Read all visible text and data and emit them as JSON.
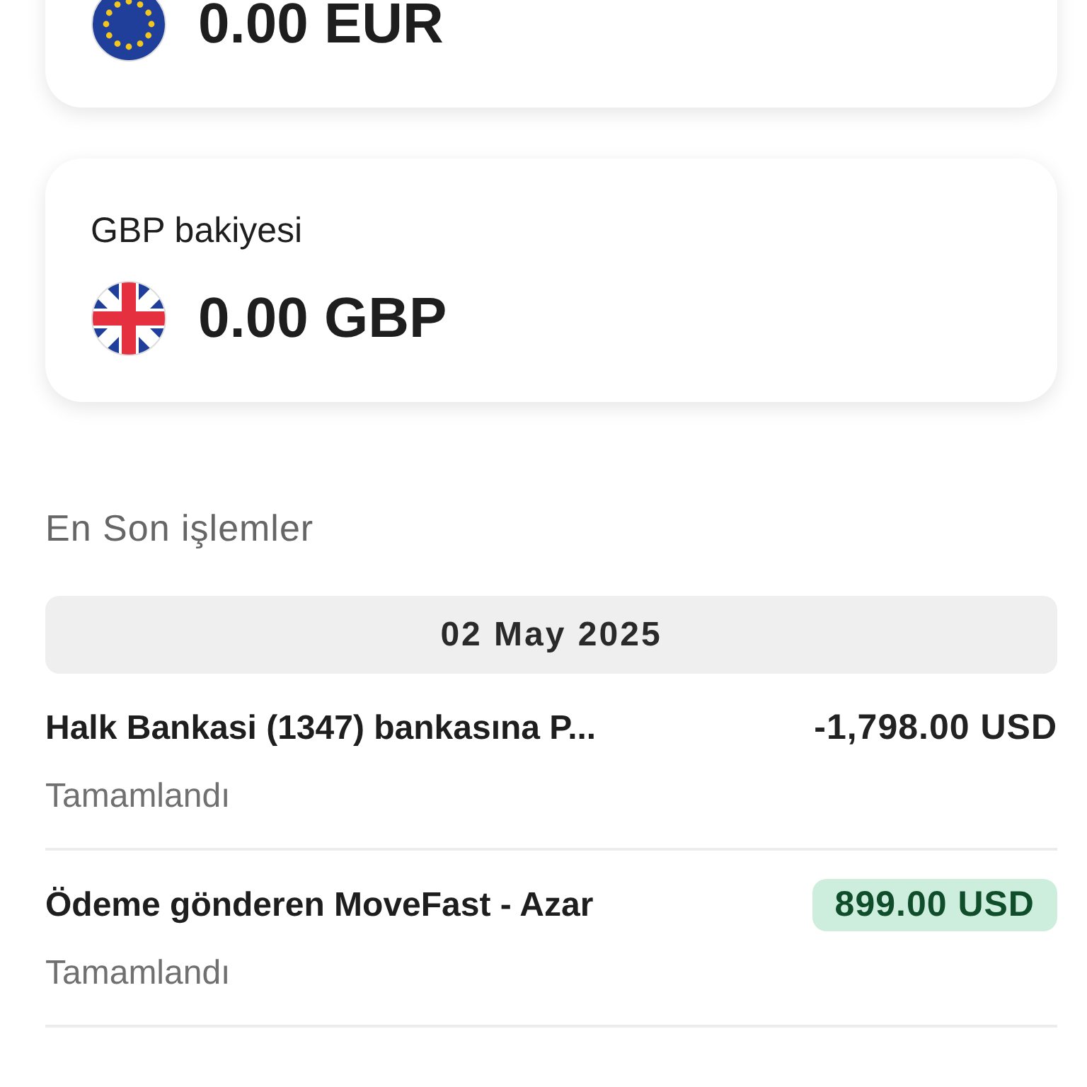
{
  "balances": [
    {
      "amount": "0.00 EUR",
      "kind": "eu"
    },
    {
      "label": "GBP bakiyesi",
      "amount": "0.00 GBP",
      "kind": "gb"
    }
  ],
  "recent": {
    "title": "En Son işlemler",
    "date": "02 May 2025",
    "transactions": [
      {
        "title": "Halk Bankasi (1347) bankasına P...",
        "amount": "-1,798.00 USD",
        "kind": "outgoing",
        "status": "Tamamlandı"
      },
      {
        "title": "Ödeme gönderen MoveFast - Azar",
        "amount": "899.00 USD",
        "kind": "incoming",
        "status": "Tamamlandı"
      }
    ]
  }
}
